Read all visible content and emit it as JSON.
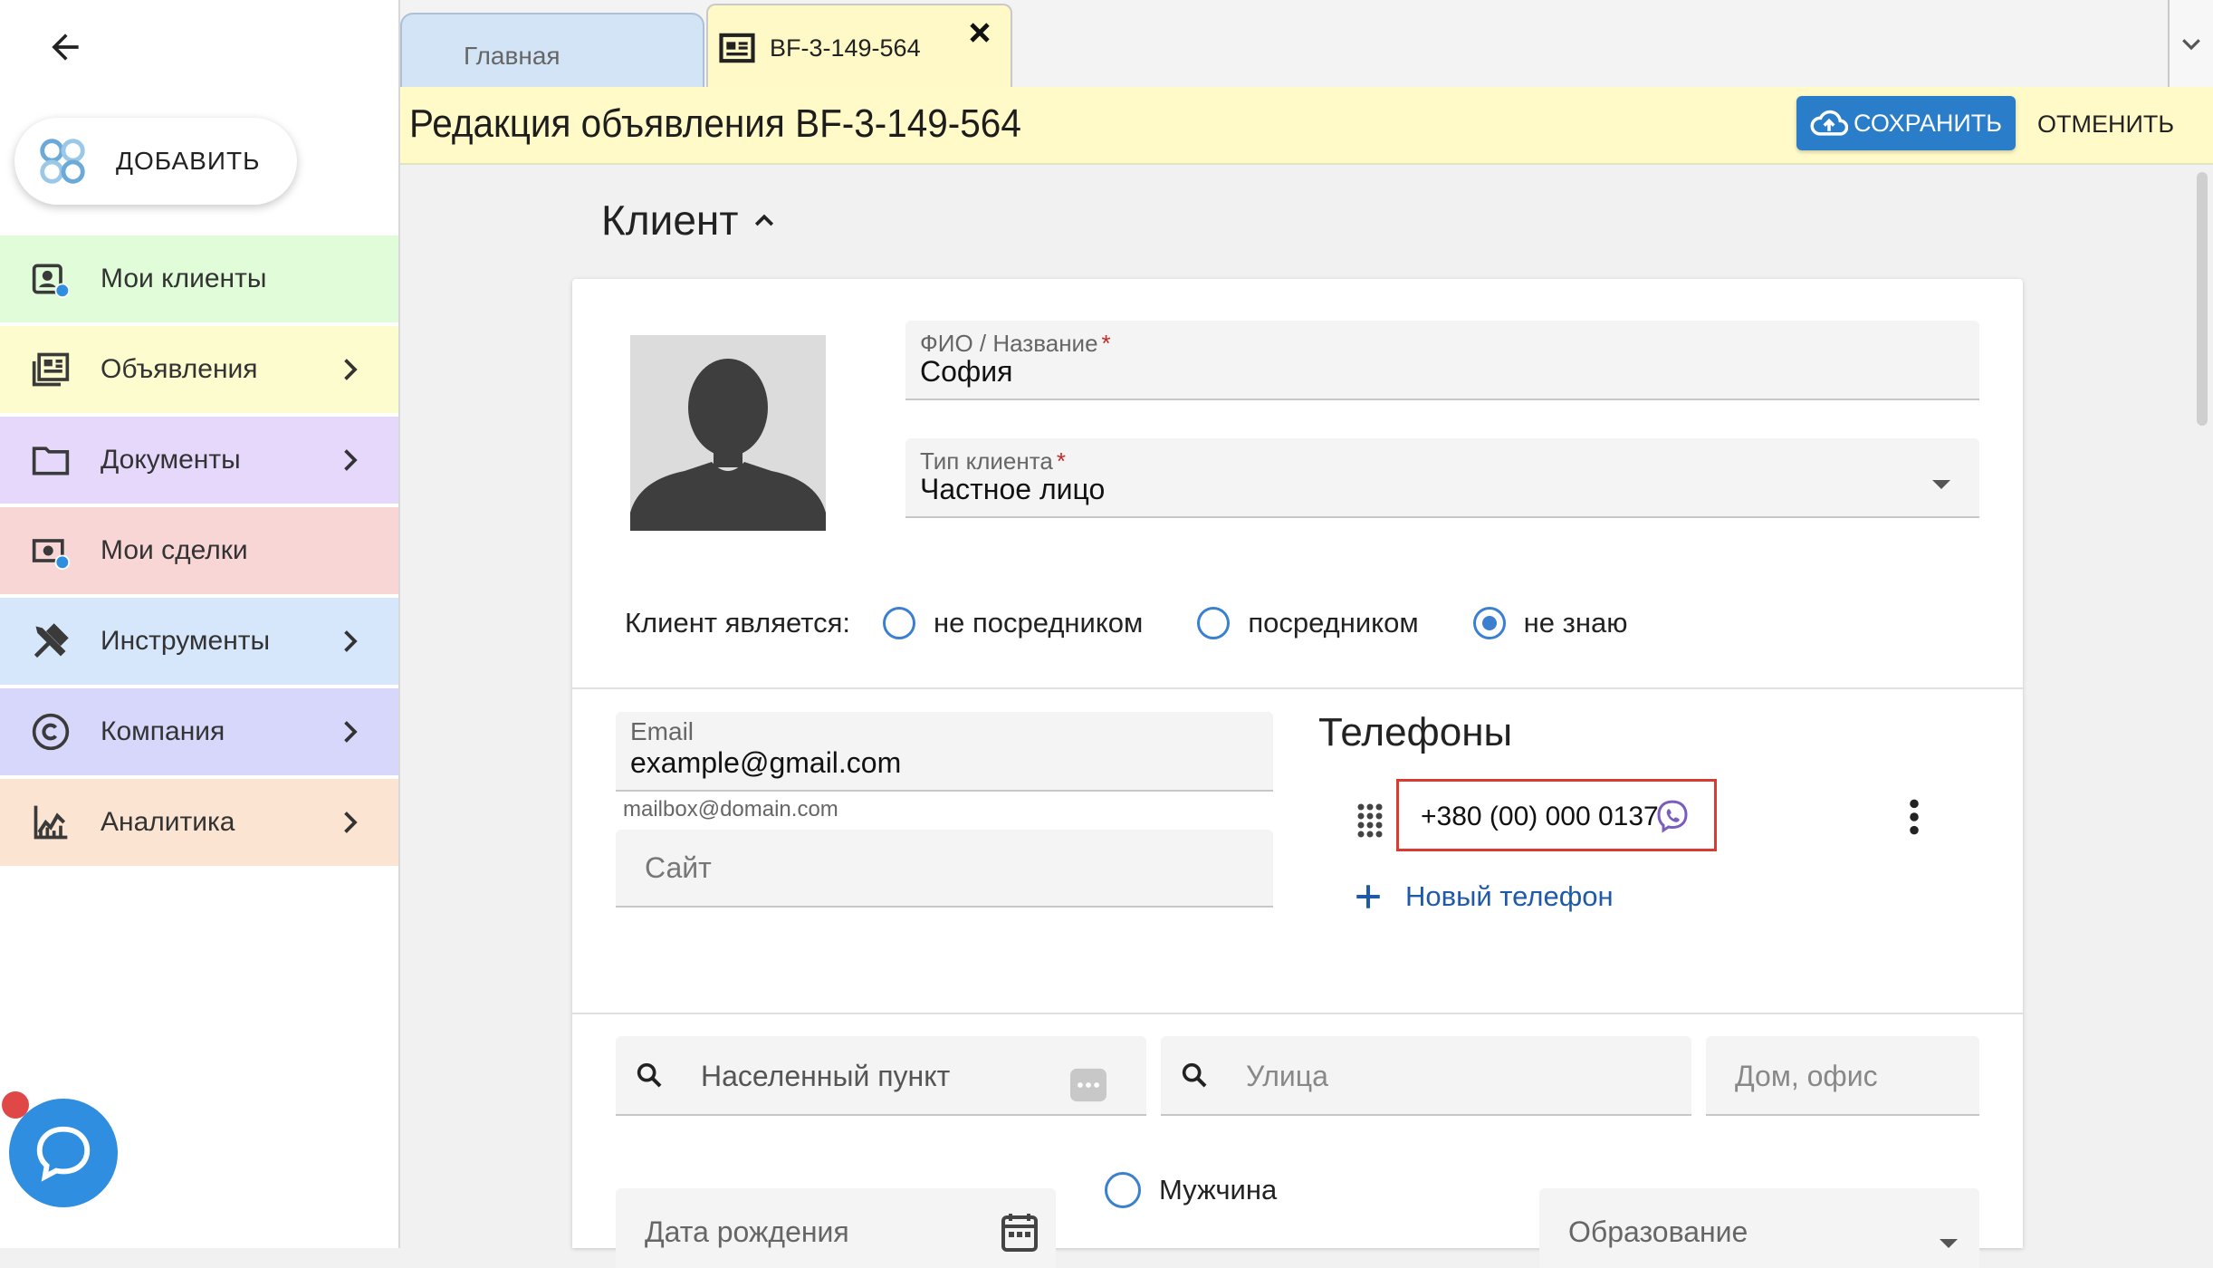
{
  "sidebar": {
    "add_label": "ДОБАВИТЬ",
    "items": [
      {
        "label": "Мои клиенты",
        "bg": "#e0fcd8",
        "has_arrow": false
      },
      {
        "label": "Объявления",
        "bg": "#fdfcce",
        "has_arrow": true
      },
      {
        "label": "Документы",
        "bg": "#e6d8fb",
        "has_arrow": true
      },
      {
        "label": "Мои сделки",
        "bg": "#f8d6d6",
        "has_arrow": false
      },
      {
        "label": "Инструменты",
        "bg": "#d6e6fb",
        "has_arrow": true
      },
      {
        "label": "Компания",
        "bg": "#d7d6fb",
        "has_arrow": true
      },
      {
        "label": "Аналитика",
        "bg": "#fbe4d2",
        "has_arrow": true
      }
    ]
  },
  "tabs": {
    "home_label": "Главная",
    "active_label": "BF-3-149-564"
  },
  "titlebar": {
    "title": "Редакция объявления BF-3-149-564",
    "save_label": "СОХРАНИТЬ",
    "cancel_label": "ОТМЕНИТЬ"
  },
  "section": {
    "title": "Клиент"
  },
  "client": {
    "name_label": "ФИО / Название",
    "name_value": "София",
    "type_label": "Тип клиента",
    "type_value": "Частное лицо",
    "required_mark": "*",
    "role_label": "Клиент является:",
    "role_options": [
      "не посредником",
      "посредником",
      "не знаю"
    ],
    "role_selected": "не знаю"
  },
  "contacts": {
    "email_label": "Email",
    "email_value": "example@gmail.com",
    "email_hint": "mailbox@domain.com",
    "site_placeholder": "Сайт",
    "phones_title": "Телефоны",
    "phone": "+380 (00) 000 0137",
    "new_phone_label": "Новый телефон"
  },
  "address": {
    "city_placeholder": "Населенный пункт",
    "street_placeholder": "Улица",
    "house_placeholder": "Дом, офис"
  },
  "extra": {
    "birth_placeholder": "Дата рождения",
    "gender_option": "Мужчина",
    "education_placeholder": "Образование"
  },
  "colors": {
    "accent": "#2a7dc8",
    "title_bg": "#fffac8",
    "highlight": "#d93a32"
  }
}
